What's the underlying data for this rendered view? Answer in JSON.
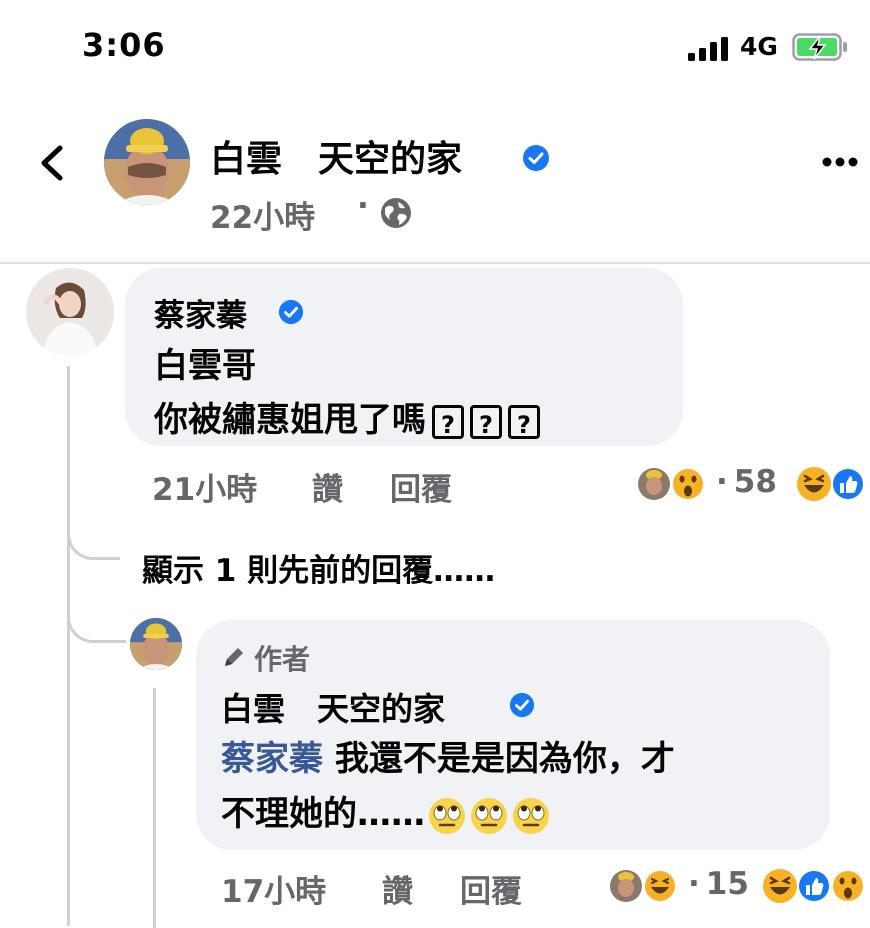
{
  "status_bar": {
    "time": "3:06",
    "network": "4G"
  },
  "header": {
    "name": "白雲　天空的家",
    "timestamp": "22小時",
    "dot": "·"
  },
  "comment1": {
    "author": "蔡家蓁",
    "line1": "白雲哥",
    "line2": "你被繡惠姐甩了嗎",
    "glyph": "?",
    "time": "21小時",
    "like_label": "讚",
    "reply_label": "回覆",
    "reaction_count": "58"
  },
  "previous_replies": "顯示 1 則先前的回覆……",
  "comment2": {
    "author_badge": "作者",
    "author": "白雲　天空的家",
    "mention": "蔡家蓁",
    "line1_rest": " 我還不是是因為你，才",
    "line2": "不理她的……",
    "time": "17小時",
    "like_label": "讚",
    "reply_label": "回覆",
    "reaction_count": "15"
  },
  "colors": {
    "verified_blue": "#1877f2",
    "bubble_gray": "#f0f2f5",
    "meta_gray": "#65676b",
    "mention_blue": "#385898"
  },
  "icons": [
    "back-icon",
    "verified-icon",
    "globe-icon",
    "more-icon",
    "pencil-icon",
    "haha-icon",
    "like-icon",
    "wow-icon",
    "eyeroll-emoji"
  ]
}
